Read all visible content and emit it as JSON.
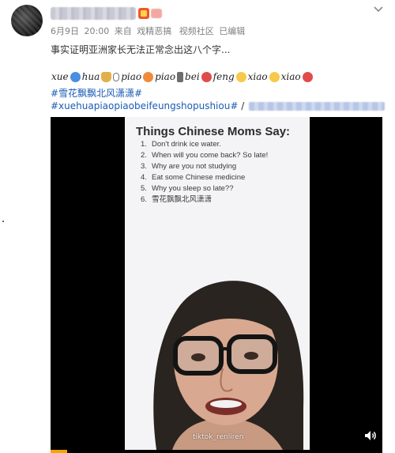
{
  "post": {
    "meta": {
      "date": "6月9日",
      "time": "20:00",
      "via_label": "来自",
      "source": "戏精恶搞",
      "channel": "视频社区",
      "edited": "已编辑"
    },
    "text": "事实证明亚洲家长无法正常念出这八个字...",
    "emoji_line": {
      "words": [
        "xue",
        "hua",
        "piao",
        "piao",
        "bei",
        "feng",
        "xiao",
        "xiao"
      ]
    },
    "topics": {
      "topic1": "#雪花飘飘北风潇潇#",
      "topic2": "#xuehuapiaopiaobeifeungshopushiou#",
      "topic2_sep": " /"
    }
  },
  "video": {
    "frame_title": "Things Chinese Moms Say:",
    "list": [
      {
        "num": "1.",
        "text": "Don't drink ice water."
      },
      {
        "num": "2.",
        "text": "When will you come back? So late!"
      },
      {
        "num": "3.",
        "text": "Why are you not studying"
      },
      {
        "num": "4.",
        "text": "Eat some Chinese medicine"
      },
      {
        "num": "5.",
        "text": "Why you sleep so late??"
      },
      {
        "num": "6.",
        "text": "雪花飘飘北风潇潇"
      }
    ],
    "watermark": "tiktok_renliren",
    "progress": 0.05
  },
  "colors": {
    "topic_link": "#1a5bb5",
    "meta_text": "#808080",
    "progress": "#f7a300"
  },
  "icons": {
    "chevron": "chevron-down-icon",
    "volume": "volume-icon"
  }
}
